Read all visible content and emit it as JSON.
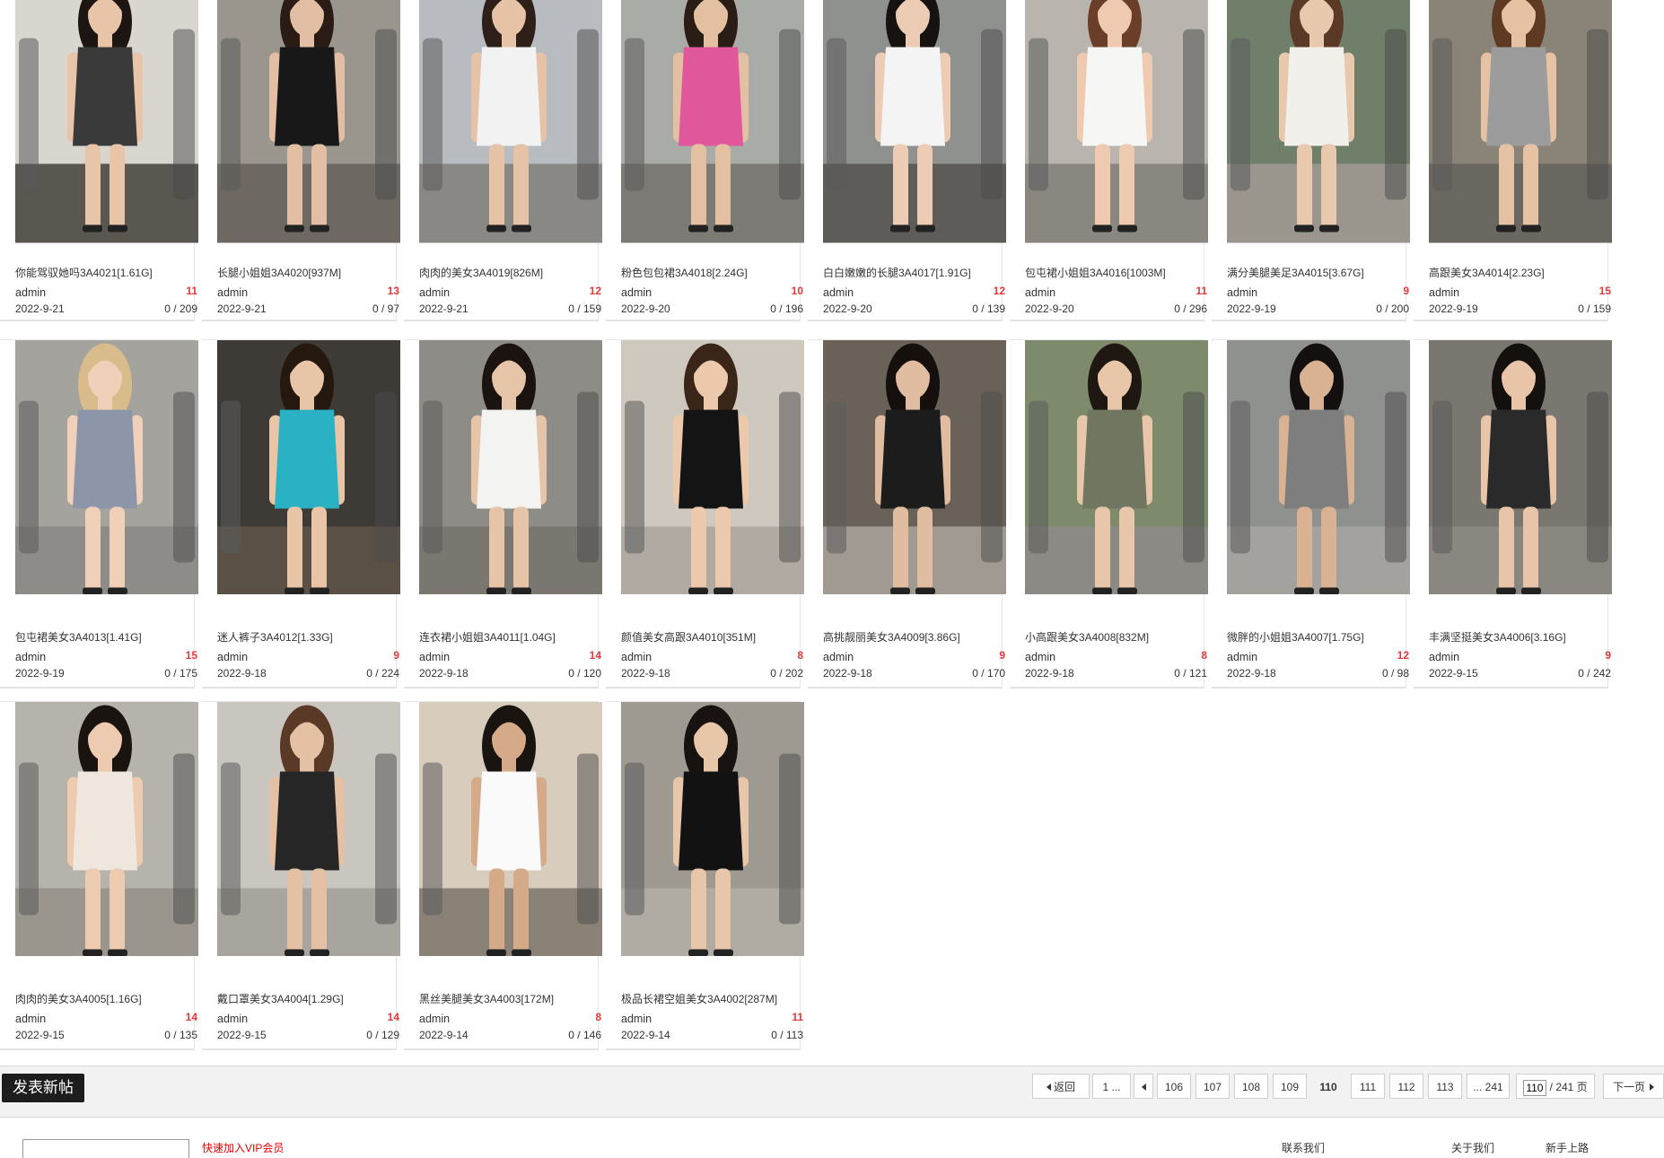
{
  "threads": [
    {
      "title": "你能驾驭她吗3A4021[1.61G]",
      "author": "admin",
      "replies": "11",
      "date": "2022-9-21",
      "views": "0 / 209",
      "photo": {
        "bg": "#d9d6d0",
        "outfit": "#3a3a3a",
        "skin": "#e8c4a8",
        "hair": "#1c1512",
        "ground": "#5a5650"
      }
    },
    {
      "title": "长腿小姐姐3A4020[937M]",
      "author": "admin",
      "replies": "13",
      "date": "2022-9-21",
      "views": "0 / 97",
      "photo": {
        "bg": "#9a968e",
        "outfit": "#181818",
        "skin": "#e2bea4",
        "hair": "#2a1c14",
        "ground": "#6d6862"
      }
    },
    {
      "title": "肉肉的美女3A4019[826M]",
      "author": "admin",
      "replies": "12",
      "date": "2022-9-21",
      "views": "0 / 159",
      "photo": {
        "bg": "#b8bcc0",
        "outfit": "#f2f2f2",
        "skin": "#e6c3a6",
        "hair": "#2e2018",
        "ground": "#8a8884"
      }
    },
    {
      "title": "粉色包包裙3A4018[2.24G]",
      "author": "admin",
      "replies": "10",
      "date": "2022-9-20",
      "views": "0 / 196",
      "photo": {
        "bg": "#a9aca6",
        "outfit": "#e0579b",
        "skin": "#e4c0a2",
        "hair": "#2a1d16",
        "ground": "#7c7a74"
      }
    },
    {
      "title": "白白嫩嫩的长腿3A4017[1.91G]",
      "author": "admin",
      "replies": "12",
      "date": "2022-9-20",
      "views": "0 / 139",
      "photo": {
        "bg": "#8e918e",
        "outfit": "#f4f4f4",
        "skin": "#ecccb4",
        "hair": "#161210",
        "ground": "#5e5c58"
      }
    },
    {
      "title": "包屯裙小姐姐3A4016[1003M]",
      "author": "admin",
      "replies": "11",
      "date": "2022-9-20",
      "views": "0 / 296",
      "photo": {
        "bg": "#b9b4ad",
        "outfit": "#f6f6f4",
        "skin": "#eecbb0",
        "hair": "#6a3e28",
        "ground": "#8a8680"
      }
    },
    {
      "title": "满分美腿美足3A4015[3.67G]",
      "author": "admin",
      "replies": "9",
      "date": "2022-9-19",
      "views": "0 / 200",
      "photo": {
        "bg": "#6f7f6a",
        "outfit": "#f1f0ea",
        "skin": "#e9c9ae",
        "hair": "#5a3a26",
        "ground": "#9a968e"
      }
    },
    {
      "title": "高跟美女3A4014[2.23G]",
      "author": "admin",
      "replies": "15",
      "date": "2022-9-19",
      "views": "0 / 159",
      "photo": {
        "bg": "#8a8478",
        "outfit": "#9c9c9c",
        "skin": "#e6c2a4",
        "hair": "#5e3a22",
        "ground": "#6a6660"
      }
    },
    {
      "title": "包屯裙美女3A4013[1.41G]",
      "author": "admin",
      "replies": "15",
      "date": "2022-9-19",
      "views": "0 / 175",
      "photo": {
        "bg": "#a4a39e",
        "outfit": "#8c96a8",
        "skin": "#f0d0b8",
        "hair": "#d8bc8c",
        "ground": "#8e8c88"
      }
    },
    {
      "title": "迷人裤子3A4012[1.33G]",
      "author": "admin",
      "replies": "9",
      "date": "2022-9-18",
      "views": "0 / 224",
      "photo": {
        "bg": "#3e3a36",
        "outfit": "#2ab1c4",
        "skin": "#e9c5a8",
        "hair": "#24180f",
        "ground": "#5a5046"
      }
    },
    {
      "title": "连衣裙小姐姐3A4011[1.04G]",
      "author": "admin",
      "replies": "14",
      "date": "2022-9-18",
      "views": "0 / 120",
      "photo": {
        "bg": "#8e8c86",
        "outfit": "#f3f3f1",
        "skin": "#e6c4a8",
        "hair": "#1a1310",
        "ground": "#7a7670"
      }
    },
    {
      "title": "颜值美女高跟3A4010[351M]",
      "author": "admin",
      "replies": "8",
      "date": "2022-9-18",
      "views": "0 / 202",
      "photo": {
        "bg": "#cfc8bf",
        "outfit": "#141414",
        "skin": "#ecc8ac",
        "hair": "#3a2618",
        "ground": "#b0aaa2"
      }
    },
    {
      "title": "高挑靓丽美女3A4009[3.86G]",
      "author": "admin",
      "replies": "9",
      "date": "2022-9-18",
      "views": "0 / 170",
      "photo": {
        "bg": "#6a6258",
        "outfit": "#1c1c1c",
        "skin": "#e0bca0",
        "hair": "#15100d",
        "ground": "#a09a92"
      }
    },
    {
      "title": "小高跟美女3A4008[832M]",
      "author": "admin",
      "replies": "8",
      "date": "2022-9-18",
      "views": "0 / 121",
      "photo": {
        "bg": "#7d8a6c",
        "outfit": "#707660",
        "skin": "#e8c6aa",
        "hair": "#1e1712",
        "ground": "#8c8a84"
      }
    },
    {
      "title": "微胖的小姐姐3A4007[1.75G]",
      "author": "admin",
      "replies": "12",
      "date": "2022-9-18",
      "views": "0 / 98",
      "photo": {
        "bg": "#8f918e",
        "outfit": "#7e7e7e",
        "skin": "#d9b294",
        "hair": "#141010",
        "ground": "#a4a29e"
      }
    },
    {
      "title": "丰满坚挺美女3A4006[3.16G]",
      "author": "admin",
      "replies": "9",
      "date": "2022-9-15",
      "views": "0 / 242",
      "photo": {
        "bg": "#7a7670",
        "outfit": "#2a2a2a",
        "skin": "#e8c4a8",
        "hair": "#14100e",
        "ground": "#8a8680"
      }
    },
    {
      "title": "肉肉的美女3A4005[1.16G]",
      "author": "admin",
      "replies": "14",
      "date": "2022-9-15",
      "views": "0 / 135",
      "photo": {
        "bg": "#b6b2ac",
        "outfit": "#efe7de",
        "skin": "#eccbb0",
        "hair": "#1a1410",
        "ground": "#9a968e"
      }
    },
    {
      "title": "戴口罩美女3A4004[1.29G]",
      "author": "admin",
      "replies": "14",
      "date": "2022-9-15",
      "views": "0 / 129",
      "photo": {
        "bg": "#c9c6c0",
        "outfit": "#262626",
        "skin": "#e4c0a4",
        "hair": "#5a3a26",
        "ground": "#a8a49e"
      }
    },
    {
      "title": "黑丝美腿美女3A4003[172M]",
      "author": "admin",
      "replies": "8",
      "date": "2022-9-14",
      "views": "0 / 146",
      "photo": {
        "bg": "#d8cdbd",
        "outfit": "#fafafa",
        "skin": "#d4aa88",
        "hair": "#1a1410",
        "ground": "#8a8276"
      }
    },
    {
      "title": "极品长裙空姐美女3A4002[287M]",
      "author": "admin",
      "replies": "11",
      "date": "2022-9-14",
      "views": "0 / 113",
      "photo": {
        "bg": "#9e9a92",
        "outfit": "#121212",
        "skin": "#e8c6aa",
        "hair": "#181210",
        "ground": "#b0aca4"
      }
    }
  ],
  "new_post_label": "发表新帖",
  "pagination": {
    "back": "返回",
    "first": "1 ...",
    "pages": [
      "106",
      "107",
      "108",
      "109",
      "110",
      "111",
      "112",
      "113"
    ],
    "current": "110",
    "last": "... 241",
    "input_value": "110",
    "total": "/ 241 页",
    "next": "下一页"
  },
  "footer": {
    "red_link": "快速加入VIP会员",
    "contact": "联系我们",
    "about": "关于我们",
    "news": "新手上路"
  }
}
